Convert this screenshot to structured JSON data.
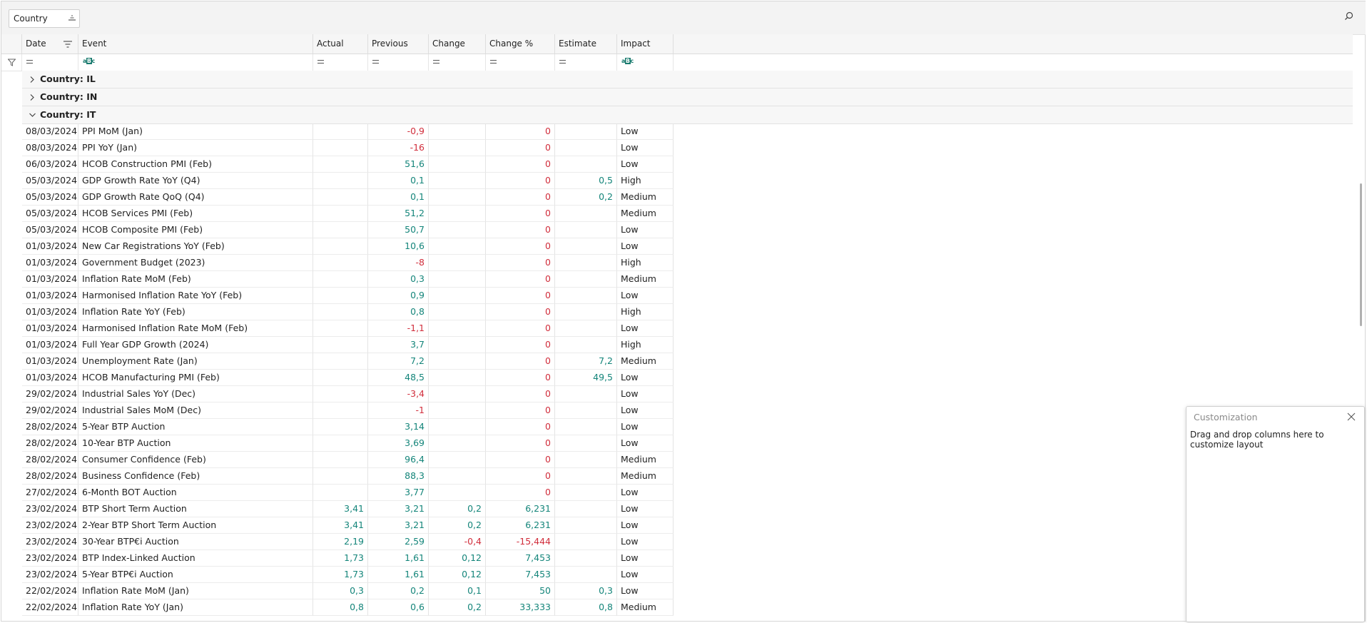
{
  "group_panel": {
    "chip_label": "Country"
  },
  "columns": [
    "Date",
    "Event",
    "Actual",
    "Previous",
    "Change",
    "Change %",
    "Estimate",
    "Impact"
  ],
  "groups": [
    {
      "label": "Country: IL",
      "expanded": false
    },
    {
      "label": "Country: IN",
      "expanded": false
    },
    {
      "label": "Country: IT",
      "expanded": true
    }
  ],
  "rows": [
    [
      "08/03/2024",
      "PPI MoM (Jan)",
      "",
      "-0,9",
      "",
      "0",
      "",
      "Low"
    ],
    [
      "08/03/2024",
      "PPI YoY (Jan)",
      "",
      "-16",
      "",
      "0",
      "",
      "Low"
    ],
    [
      "06/03/2024",
      "HCOB Construction PMI (Feb)",
      "",
      "51,6",
      "",
      "0",
      "",
      "Low"
    ],
    [
      "05/03/2024",
      "GDP Growth Rate YoY (Q4)",
      "",
      "0,1",
      "",
      "0",
      "0,5",
      "High"
    ],
    [
      "05/03/2024",
      "GDP Growth Rate QoQ (Q4)",
      "",
      "0,1",
      "",
      "0",
      "0,2",
      "Medium"
    ],
    [
      "05/03/2024",
      "HCOB Services PMI (Feb)",
      "",
      "51,2",
      "",
      "0",
      "",
      "Medium"
    ],
    [
      "05/03/2024",
      "HCOB Composite PMI (Feb)",
      "",
      "50,7",
      "",
      "0",
      "",
      "Low"
    ],
    [
      "01/03/2024",
      "New Car Registrations YoY (Feb)",
      "",
      "10,6",
      "",
      "0",
      "",
      "Low"
    ],
    [
      "01/03/2024",
      "Government Budget (2023)",
      "",
      "-8",
      "",
      "0",
      "",
      "High"
    ],
    [
      "01/03/2024",
      "Inflation Rate MoM (Feb)",
      "",
      "0,3",
      "",
      "0",
      "",
      "Medium"
    ],
    [
      "01/03/2024",
      "Harmonised Inflation Rate YoY (Feb)",
      "",
      "0,9",
      "",
      "0",
      "",
      "Low"
    ],
    [
      "01/03/2024",
      "Inflation Rate YoY (Feb)",
      "",
      "0,8",
      "",
      "0",
      "",
      "High"
    ],
    [
      "01/03/2024",
      "Harmonised Inflation Rate MoM (Feb)",
      "",
      "-1,1",
      "",
      "0",
      "",
      "Low"
    ],
    [
      "01/03/2024",
      "Full Year GDP Growth (2024)",
      "",
      "3,7",
      "",
      "0",
      "",
      "High"
    ],
    [
      "01/03/2024",
      "Unemployment Rate (Jan)",
      "",
      "7,2",
      "",
      "0",
      "7,2",
      "Medium"
    ],
    [
      "01/03/2024",
      "HCOB Manufacturing PMI (Feb)",
      "",
      "48,5",
      "",
      "0",
      "49,5",
      "Low"
    ],
    [
      "29/02/2024",
      "Industrial Sales YoY (Dec)",
      "",
      "-3,4",
      "",
      "0",
      "",
      "Low"
    ],
    [
      "29/02/2024",
      "Industrial Sales MoM (Dec)",
      "",
      "-1",
      "",
      "0",
      "",
      "Low"
    ],
    [
      "28/02/2024",
      "5-Year BTP Auction",
      "",
      "3,14",
      "",
      "0",
      "",
      "Low"
    ],
    [
      "28/02/2024",
      "10-Year BTP Auction",
      "",
      "3,69",
      "",
      "0",
      "",
      "Low"
    ],
    [
      "28/02/2024",
      "Consumer Confidence (Feb)",
      "",
      "96,4",
      "",
      "0",
      "",
      "Medium"
    ],
    [
      "28/02/2024",
      "Business Confidence (Feb)",
      "",
      "88,3",
      "",
      "0",
      "",
      "Medium"
    ],
    [
      "27/02/2024",
      "6-Month BOT Auction",
      "",
      "3,77",
      "",
      "0",
      "",
      "Low"
    ],
    [
      "23/02/2024",
      "BTP Short Term Auction",
      "3,41",
      "3,21",
      "0,2",
      "6,231",
      "",
      "Low"
    ],
    [
      "23/02/2024",
      "2-Year BTP Short Term Auction",
      "3,41",
      "3,21",
      "0,2",
      "6,231",
      "",
      "Low"
    ],
    [
      "23/02/2024",
      "30-Year BTP€i Auction",
      "2,19",
      "2,59",
      "-0,4",
      "-15,444",
      "",
      "Low"
    ],
    [
      "23/02/2024",
      "BTP Index-Linked Auction",
      "1,73",
      "1,61",
      "0,12",
      "7,453",
      "",
      "Low"
    ],
    [
      "23/02/2024",
      "5-Year BTP€i Auction",
      "1,73",
      "1,61",
      "0,12",
      "7,453",
      "",
      "Low"
    ],
    [
      "22/02/2024",
      "Inflation Rate MoM (Jan)",
      "0,3",
      "0,2",
      "0,1",
      "50",
      "0,3",
      "Low"
    ],
    [
      "22/02/2024",
      "Inflation Rate YoY (Jan)",
      "0,8",
      "0,6",
      "0,2",
      "33,333",
      "0,8",
      "Medium"
    ]
  ],
  "customization": {
    "title": "Customization",
    "body": "Drag and drop columns here to customize layout"
  },
  "colors": {
    "positive": "#14857a",
    "negative": "#d12e3c",
    "zero": "#d12e3c"
  }
}
